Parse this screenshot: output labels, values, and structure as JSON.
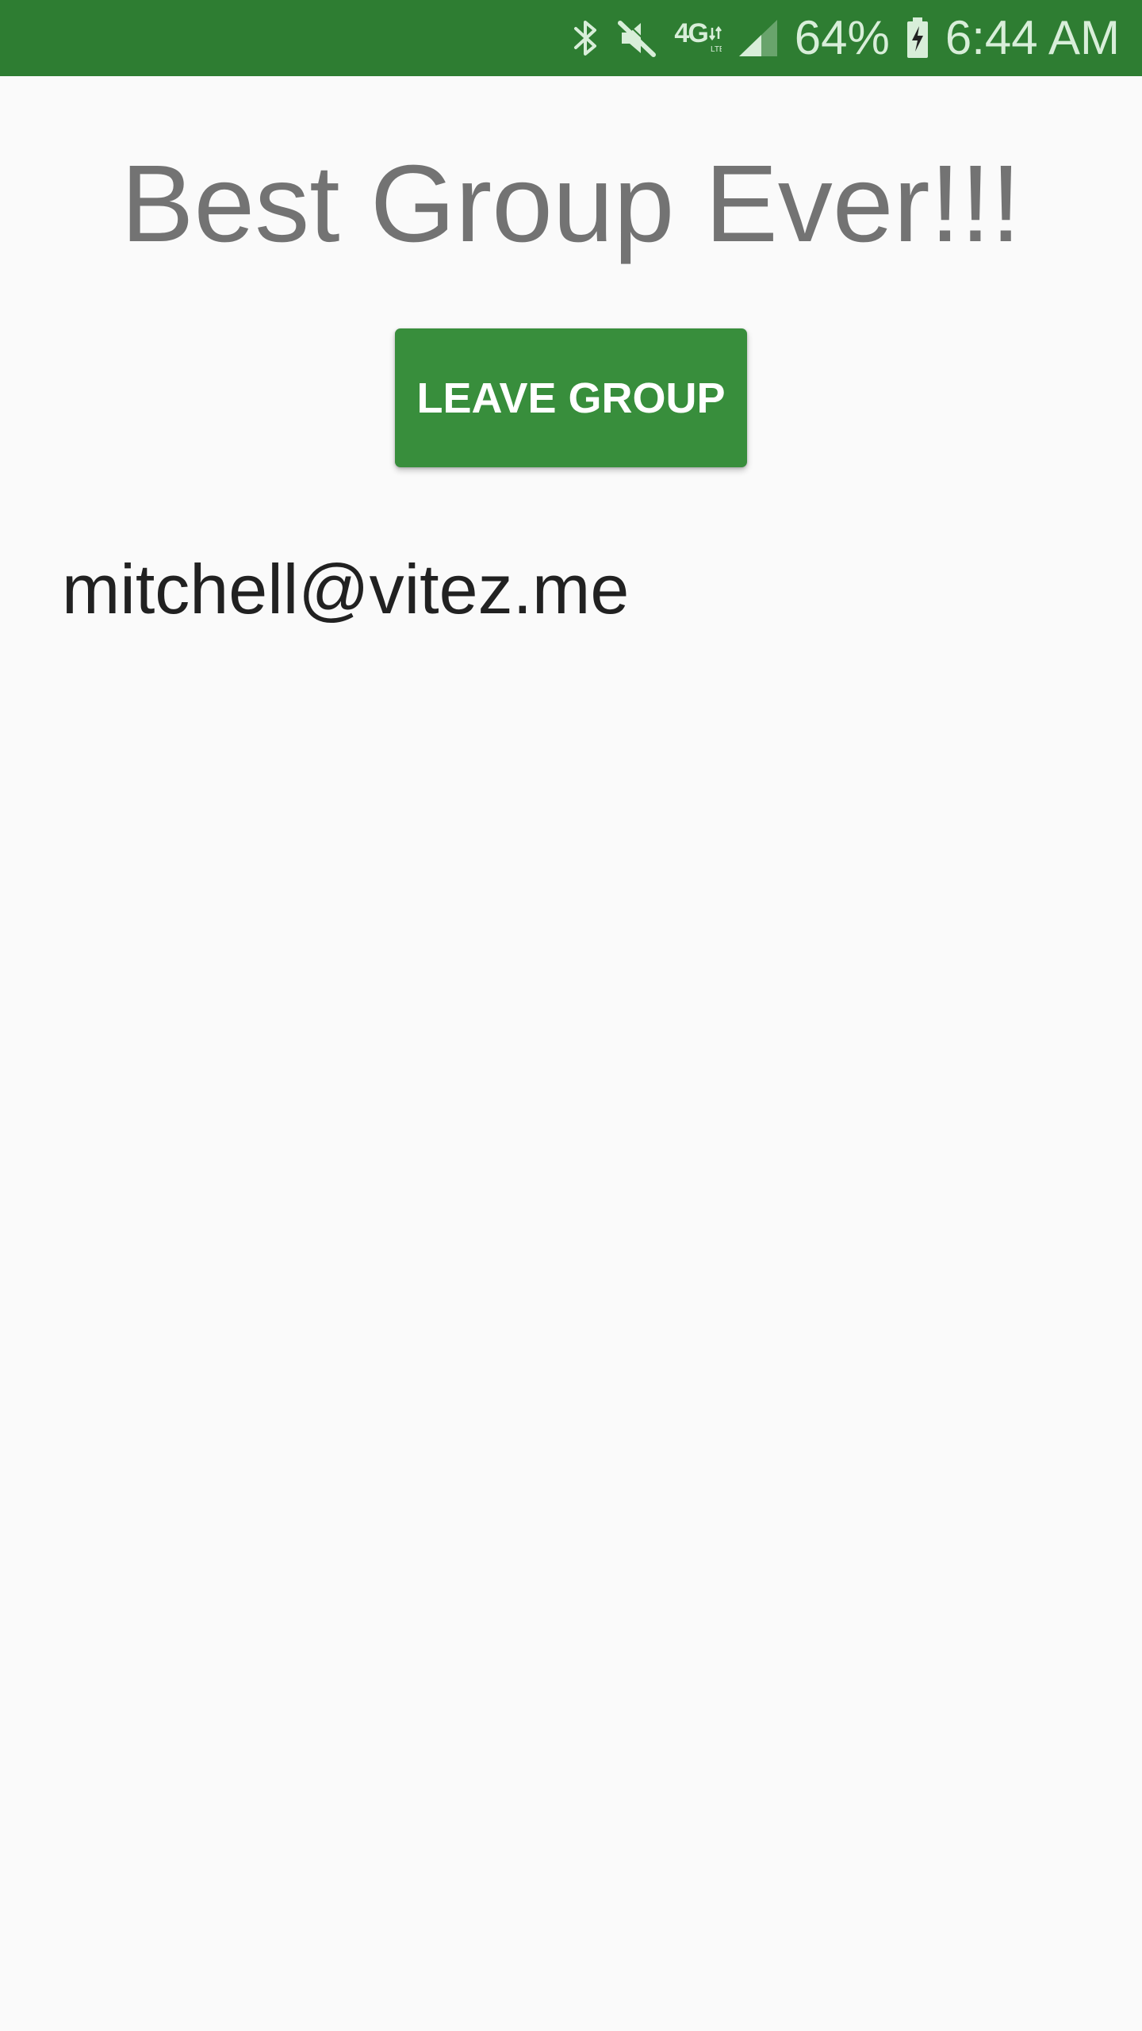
{
  "status_bar": {
    "icons": [
      "bluetooth-icon",
      "mute-icon",
      "network-4g-lte-icon",
      "signal-icon",
      "battery-charging-icon"
    ],
    "network_label": "4G",
    "battery_percent": "64%",
    "battery_level": 0.64,
    "time": "6:44 AM",
    "colors": {
      "background": "#2e7d32",
      "foreground": "#d8eed9"
    }
  },
  "group": {
    "title": "Best Group Ever!!!",
    "leave_button_label": "LEAVE GROUP",
    "members": [
      "mitchell@vitez.me"
    ]
  },
  "colors": {
    "accent": "#388e3c",
    "title_text": "#737373",
    "body_text": "#212121",
    "background": "#fafafa"
  }
}
